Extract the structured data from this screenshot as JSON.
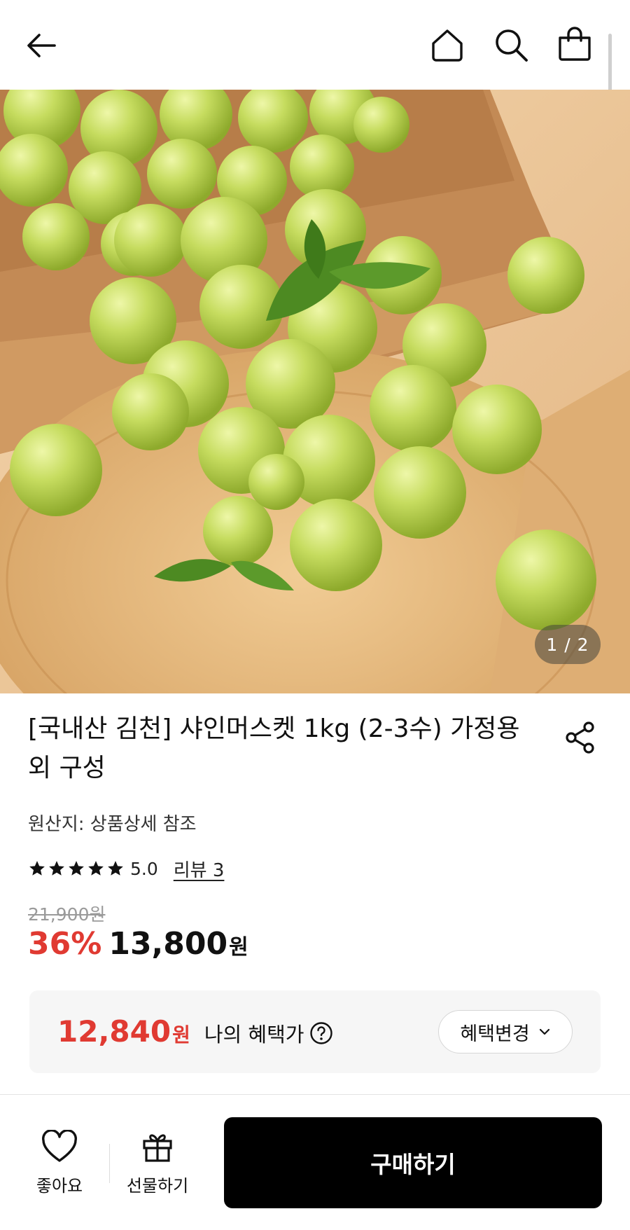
{
  "header": {
    "back_icon": "arrow-left-icon",
    "home_icon": "home-icon",
    "search_icon": "search-icon",
    "cart_icon": "shopping-bag-icon"
  },
  "gallery": {
    "page_indicator": "1 / 2",
    "image_subject": "Shine Muscat green grapes on a wooden board"
  },
  "product": {
    "title": "[국내산 김천] 샤인머스켓 1kg (2-3수) 가정용 외 구성",
    "share_icon": "share-icon",
    "origin": "원산지: 상품상세 참조",
    "rating": {
      "stars": 5,
      "value": "5.0",
      "review_link": "리뷰 3"
    },
    "original_price": "21,900원",
    "discount_rate": "36%",
    "sale_price": "13,800",
    "sale_unit": "원"
  },
  "benefit": {
    "price": "12,840",
    "unit": "원",
    "label": "나의 혜택가",
    "button": "혜택변경",
    "accent": "#e03a32"
  },
  "bottom_bar": {
    "like_label": "좋아요",
    "gift_label": "선물하기",
    "buy_label": "구매하기"
  }
}
